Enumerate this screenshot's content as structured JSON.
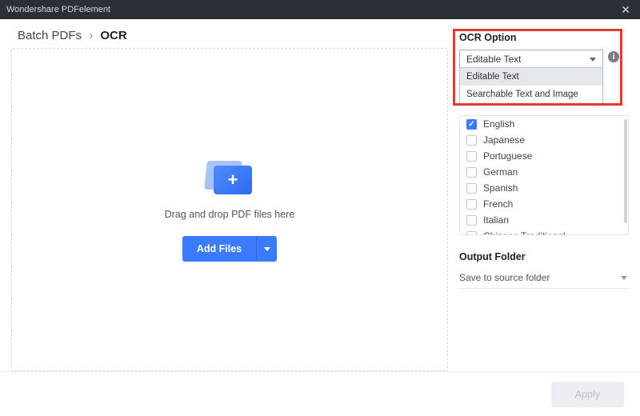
{
  "titlebar": {
    "app_name": "Wondershare PDFelement"
  },
  "breadcrumb": {
    "parent": "Batch PDFs",
    "current": "OCR"
  },
  "dropzone": {
    "hint": "Drag and drop PDF files here",
    "add_button": "Add Files"
  },
  "ocr_option": {
    "label": "OCR Option",
    "selected": "Editable Text",
    "items": [
      "Editable Text",
      "Searchable Text and Image"
    ]
  },
  "languages": {
    "items": [
      {
        "label": "English",
        "checked": true
      },
      {
        "label": "Japanese",
        "checked": false
      },
      {
        "label": "Portuguese",
        "checked": false
      },
      {
        "label": "German",
        "checked": false
      },
      {
        "label": "Spanish",
        "checked": false
      },
      {
        "label": "French",
        "checked": false
      },
      {
        "label": "Italian",
        "checked": false
      },
      {
        "label": "Chinese Traditional",
        "checked": false
      }
    ]
  },
  "output": {
    "label": "Output Folder",
    "selected": "Save to source folder"
  },
  "footer": {
    "apply": "Apply"
  }
}
